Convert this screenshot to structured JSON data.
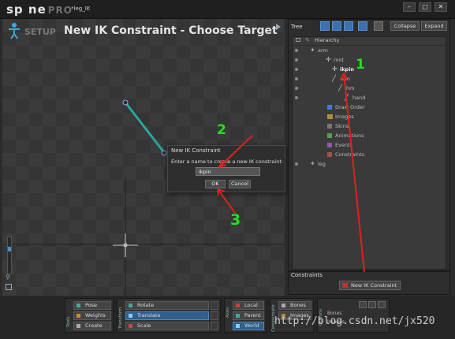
{
  "app": {
    "logo": "sp ne",
    "logo_pro": "PRO",
    "file_title": "*leg_IK"
  },
  "viewport": {
    "mode": "SETUP",
    "title": "New IK Constraint - Choose Target"
  },
  "dialog": {
    "title": "New IK Constraint",
    "prompt": "Enter a name to create a new IK constraint:",
    "input_value": "ikpin",
    "ok_label": "OK",
    "cancel_label": "Cancel"
  },
  "tree": {
    "title": "Tree",
    "collapse_label": "Collapse",
    "expand_label": "Expand",
    "hierarchy_label": "Hierarchy",
    "rows": [
      {
        "label": "arm",
        "indent": 0
      },
      {
        "label": "root",
        "indent": 1
      },
      {
        "label": "ikpin",
        "indent": 2
      },
      {
        "label": "arm",
        "indent": 3
      },
      {
        "label": "hm",
        "indent": 4
      },
      {
        "label": "hand",
        "indent": 5
      },
      {
        "label": "Draw Order",
        "indent": 2
      },
      {
        "label": "Images",
        "indent": 2
      },
      {
        "label": "Skins",
        "indent": 2
      },
      {
        "label": "Animations",
        "indent": 2
      },
      {
        "label": "Events",
        "indent": 2
      },
      {
        "label": "Constraints",
        "indent": 2
      },
      {
        "label": "leg",
        "indent": 0
      }
    ]
  },
  "constraints": {
    "title": "Constraints",
    "new_button": "New IK Constraint"
  },
  "toolbar": {
    "tools_label": "Tools",
    "tools": [
      "Pose",
      "Weights",
      "Create"
    ],
    "transform_label": "Transform",
    "transform": [
      "Rotate",
      "Translate",
      "Scale"
    ],
    "axes_label": "Axes",
    "axes": [
      "Local",
      "Parent",
      "World"
    ],
    "compensate_label": "Compensate",
    "compensate": [
      "Bones",
      "Images"
    ],
    "options_label": "Options",
    "options": [
      "Bones",
      "Images"
    ]
  },
  "annotations": {
    "num1": "1",
    "num2": "2",
    "num3": "3"
  },
  "watermark": "http://blog.csdn.net/jx520",
  "colors": {
    "accent": "#3a7fd5",
    "annotation_red": "#e02020",
    "annotation_green": "#22e022",
    "bone": "#2aa6a0"
  }
}
